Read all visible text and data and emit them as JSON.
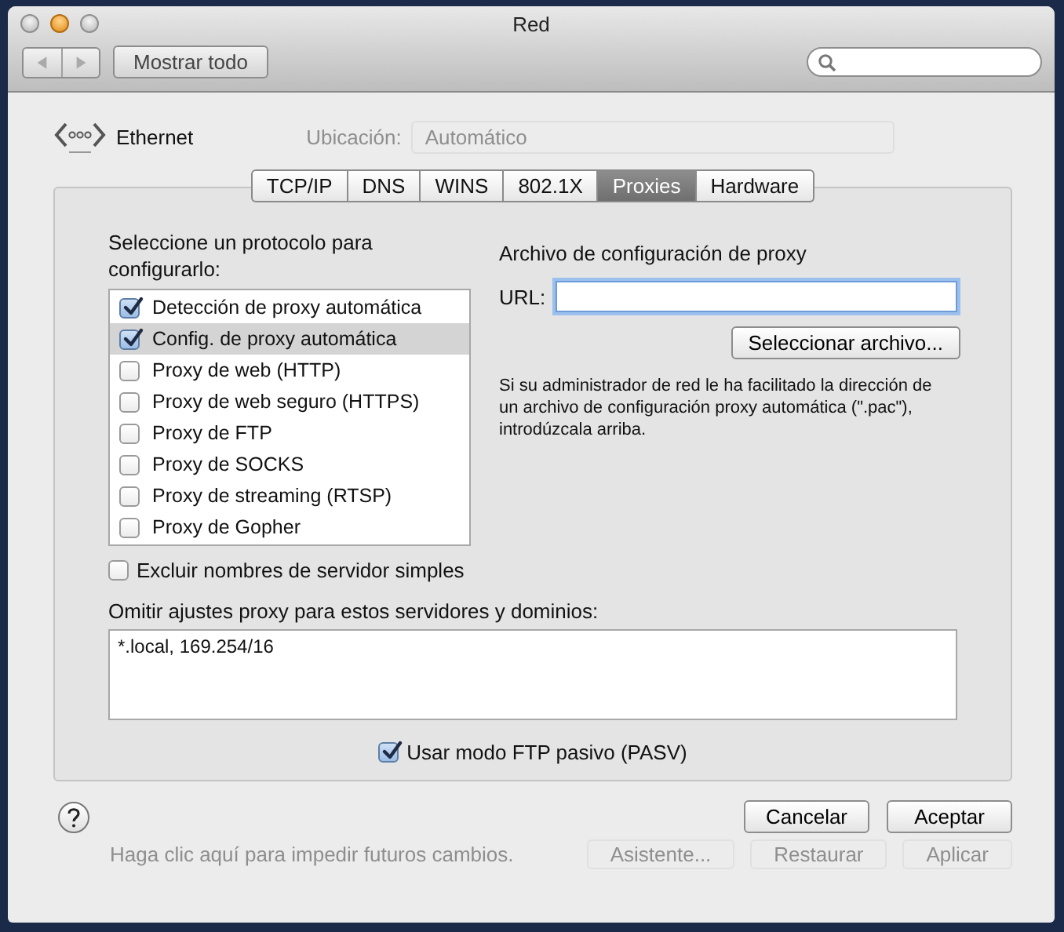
{
  "window": {
    "title": "Red"
  },
  "toolbar": {
    "show_all_button": "Mostrar todo"
  },
  "service": {
    "name": "Ethernet"
  },
  "location": {
    "label": "Ubicación:",
    "value": "Automático"
  },
  "tabs": [
    {
      "label": "TCP/IP",
      "selected": false
    },
    {
      "label": "DNS",
      "selected": false
    },
    {
      "label": "WINS",
      "selected": false
    },
    {
      "label": "802.1X",
      "selected": false
    },
    {
      "label": "Proxies",
      "selected": true
    },
    {
      "label": "Hardware",
      "selected": false
    }
  ],
  "protocols": {
    "label": "Seleccione un protocolo para configurarlo:",
    "items": [
      {
        "label": "Detección de proxy automática",
        "checked": true,
        "selected": false
      },
      {
        "label": "Config. de proxy automática",
        "checked": true,
        "selected": true
      },
      {
        "label": "Proxy de web (HTTP)",
        "checked": false,
        "selected": false
      },
      {
        "label": "Proxy de web seguro (HTTPS)",
        "checked": false,
        "selected": false
      },
      {
        "label": "Proxy de FTP",
        "checked": false,
        "selected": false
      },
      {
        "label": "Proxy de SOCKS",
        "checked": false,
        "selected": false
      },
      {
        "label": "Proxy de streaming (RTSP)",
        "checked": false,
        "selected": false
      },
      {
        "label": "Proxy de Gopher",
        "checked": false,
        "selected": false
      }
    ]
  },
  "exclude_simple_hostnames": {
    "label": "Excluir nombres de servidor simples",
    "checked": false
  },
  "proxy_file": {
    "title": "Archivo de configuración de proxy",
    "url_label": "URL:",
    "choose_button": "Seleccionar archivo...",
    "help": "Si su administrador de red le ha facilitado la dirección de un archivo de configuración proxy automática (\".pac\"), introdúzcala arriba."
  },
  "bypass": {
    "label": "Omitir ajustes proxy para estos servidores y dominios:",
    "value": "*.local, 169.254/16"
  },
  "passive_ftp": {
    "label": "Usar modo FTP pasivo (PASV)",
    "checked": true
  },
  "buttons": {
    "cancel": "Cancelar",
    "ok": "Aceptar"
  },
  "background_bar": {
    "lock_text": "Haga clic aquí para impedir futuros cambios.",
    "buttons": [
      "Asistente...",
      "Restaurar",
      "Aplicar"
    ]
  }
}
